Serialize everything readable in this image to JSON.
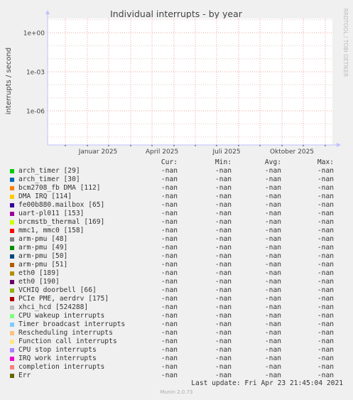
{
  "chart_data": {
    "type": "line",
    "title": "Individual interrupts - by year",
    "ylabel": "interrupts / second",
    "yscale": "log",
    "yticks": [
      "1e+00",
      "1e-03",
      "1e-06"
    ],
    "xticks": [
      "Januar 2025",
      "April 2025",
      "Juli 2025",
      "Oktober 2025"
    ],
    "watermark": "RRDTOOL / TOBI OETIKER",
    "grid": true,
    "series": []
  },
  "legend": {
    "headers": {
      "cur": "Cur:",
      "min": "Min:",
      "avg": "Avg:",
      "max": "Max:"
    },
    "rows": [
      {
        "name": "arch_timer [29]",
        "color": "#00cc00",
        "cur": "-nan",
        "min": "-nan",
        "avg": "-nan",
        "max": "-nan"
      },
      {
        "name": "arch_timer [30]",
        "color": "#0066b3",
        "cur": "-nan",
        "min": "-nan",
        "avg": "-nan",
        "max": "-nan"
      },
      {
        "name": "bcm2708_fb DMA [112]",
        "color": "#ff8000",
        "cur": "-nan",
        "min": "-nan",
        "avg": "-nan",
        "max": "-nan"
      },
      {
        "name": "DMA IRQ [114]",
        "color": "#ffcc00",
        "cur": "-nan",
        "min": "-nan",
        "avg": "-nan",
        "max": "-nan"
      },
      {
        "name": "fe00b880.mailbox [65]",
        "color": "#330099",
        "cur": "-nan",
        "min": "-nan",
        "avg": "-nan",
        "max": "-nan"
      },
      {
        "name": "uart-pl011 [153]",
        "color": "#990099",
        "cur": "-nan",
        "min": "-nan",
        "avg": "-nan",
        "max": "-nan"
      },
      {
        "name": "brcmstb_thermal [169]",
        "color": "#ccff00",
        "cur": "-nan",
        "min": "-nan",
        "avg": "-nan",
        "max": "-nan"
      },
      {
        "name": "mmc1, mmc0 [158]",
        "color": "#ff0000",
        "cur": "-nan",
        "min": "-nan",
        "avg": "-nan",
        "max": "-nan"
      },
      {
        "name": "arm-pmu [48]",
        "color": "#808080",
        "cur": "-nan",
        "min": "-nan",
        "avg": "-nan",
        "max": "-nan"
      },
      {
        "name": "arm-pmu [49]",
        "color": "#008f00",
        "cur": "-nan",
        "min": "-nan",
        "avg": "-nan",
        "max": "-nan"
      },
      {
        "name": "arm-pmu [50]",
        "color": "#00487d",
        "cur": "-nan",
        "min": "-nan",
        "avg": "-nan",
        "max": "-nan"
      },
      {
        "name": "arm-pmu [51]",
        "color": "#b35a00",
        "cur": "-nan",
        "min": "-nan",
        "avg": "-nan",
        "max": "-nan"
      },
      {
        "name": "eth0 [189]",
        "color": "#b38f00",
        "cur": "-nan",
        "min": "-nan",
        "avg": "-nan",
        "max": "-nan"
      },
      {
        "name": "eth0 [190]",
        "color": "#6b006b",
        "cur": "-nan",
        "min": "-nan",
        "avg": "-nan",
        "max": "-nan"
      },
      {
        "name": "VCHIQ doorbell [66]",
        "color": "#8fb300",
        "cur": "-nan",
        "min": "-nan",
        "avg": "-nan",
        "max": "-nan"
      },
      {
        "name": "PCIe PME, aerdrv [175]",
        "color": "#b30000",
        "cur": "-nan",
        "min": "-nan",
        "avg": "-nan",
        "max": "-nan"
      },
      {
        "name": "xhci_hcd [524288]",
        "color": "#bebebe",
        "cur": "-nan",
        "min": "-nan",
        "avg": "-nan",
        "max": "-nan"
      },
      {
        "name": "CPU wakeup interrupts",
        "color": "#80ff80",
        "cur": "-nan",
        "min": "-nan",
        "avg": "-nan",
        "max": "-nan"
      },
      {
        "name": "Timer broadcast interrupts",
        "color": "#80c9ff",
        "cur": "-nan",
        "min": "-nan",
        "avg": "-nan",
        "max": "-nan"
      },
      {
        "name": "Rescheduling interrupts",
        "color": "#ffc080",
        "cur": "-nan",
        "min": "-nan",
        "avg": "-nan",
        "max": "-nan"
      },
      {
        "name": "Function call interrupts",
        "color": "#ffe680",
        "cur": "-nan",
        "min": "-nan",
        "avg": "-nan",
        "max": "-nan"
      },
      {
        "name": "CPU stop interrupts",
        "color": "#aa80ff",
        "cur": "-nan",
        "min": "-nan",
        "avg": "-nan",
        "max": "-nan"
      },
      {
        "name": "IRQ work interrupts",
        "color": "#ee00cc",
        "cur": "-nan",
        "min": "-nan",
        "avg": "-nan",
        "max": "-nan"
      },
      {
        "name": "completion interrupts",
        "color": "#ff8080",
        "cur": "-nan",
        "min": "-nan",
        "avg": "-nan",
        "max": "-nan"
      },
      {
        "name": "Err",
        "color": "#666600",
        "cur": "-nan",
        "min": "-nan",
        "avg": "-nan",
        "max": "-nan"
      }
    ]
  },
  "last_update": "Last update: Fri Apr 23 21:45:04 2021",
  "footer": "Munin 2.0.73"
}
